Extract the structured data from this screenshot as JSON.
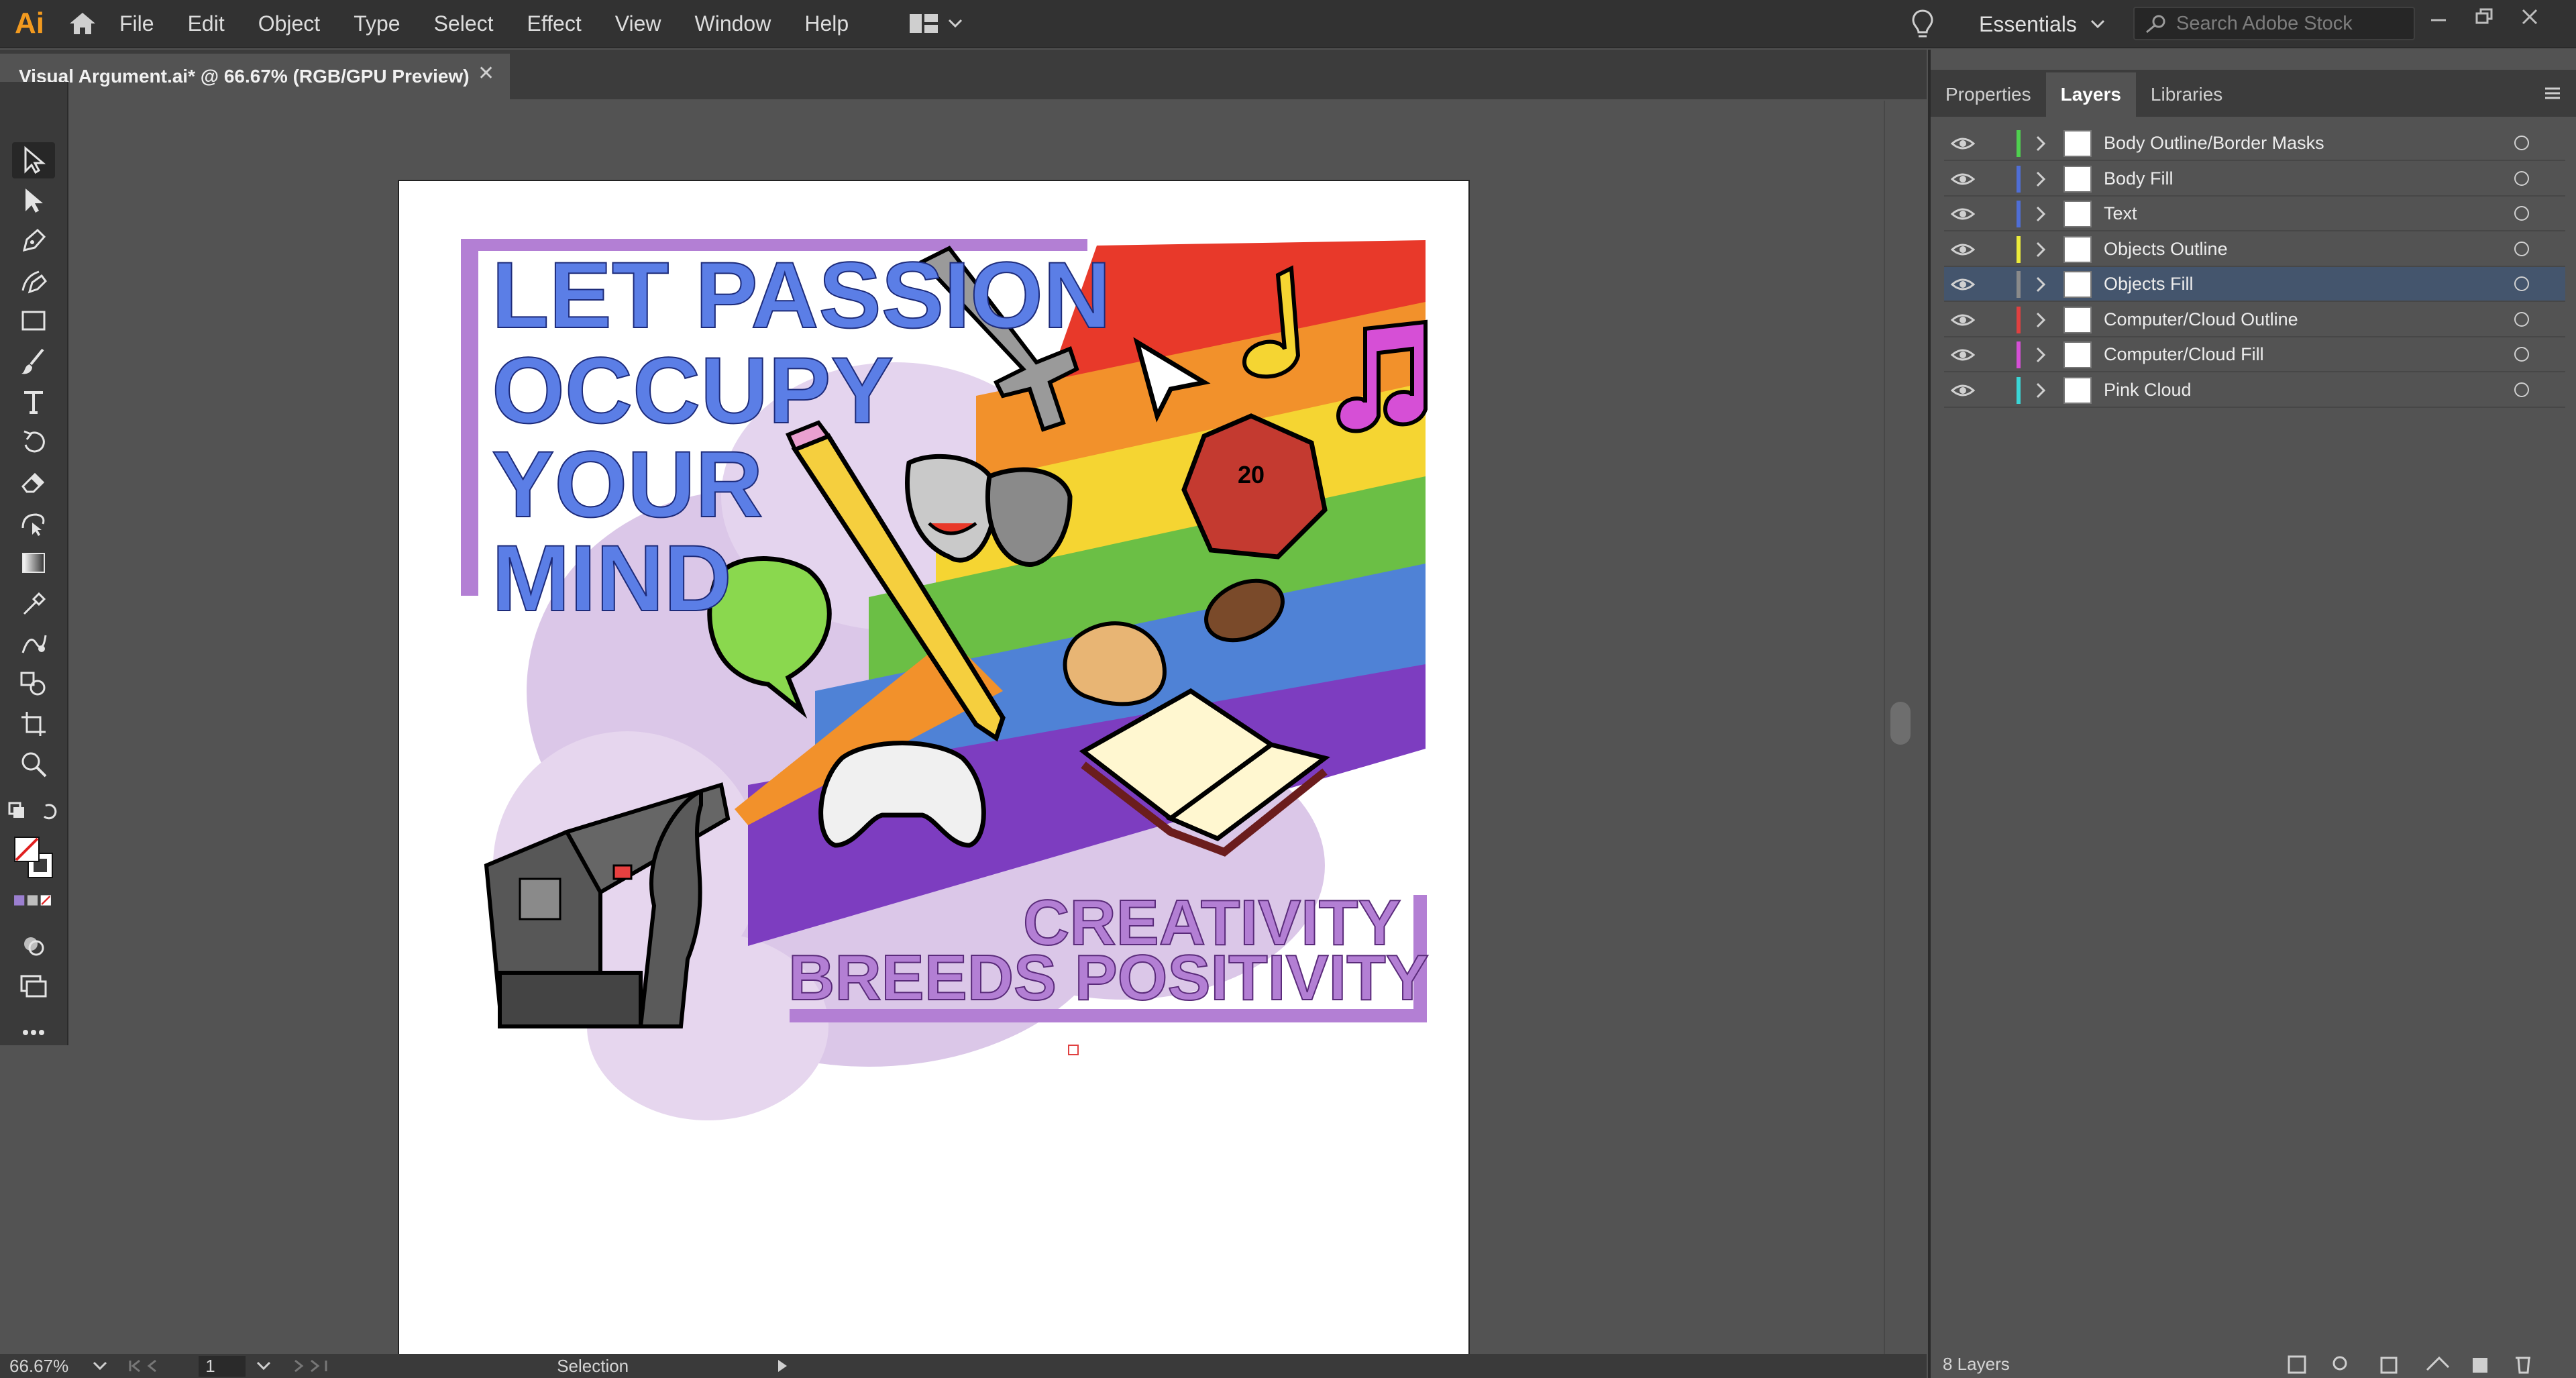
{
  "app": {
    "logo": "Ai",
    "menu": [
      "File",
      "Edit",
      "Object",
      "Type",
      "Select",
      "Effect",
      "View",
      "Window",
      "Help"
    ],
    "workspace": "Essentials",
    "search_placeholder": "Search Adobe Stock"
  },
  "document": {
    "tab_title": "Visual Argument.ai* @ 66.67% (RGB/GPU Preview)",
    "close_glyph": "✕"
  },
  "artwork": {
    "headline": [
      "LET PASSION",
      "OCCUPY",
      "YOUR",
      "MIND"
    ],
    "tagline": [
      "CREATIVITY",
      "BREEDS POSITIVITY"
    ],
    "dice_label": "20",
    "colors": {
      "headline": "#5b7ee6",
      "tagline": "#b37fd4",
      "purple_frame": "#b37fd4",
      "pink_cloud": "#d9c3e6"
    }
  },
  "status": {
    "zoom": "66.67%",
    "artboard": "1",
    "tool": "Selection"
  },
  "panel": {
    "tabs": [
      "Properties",
      "Layers",
      "Libraries"
    ],
    "active_tab": "Layers",
    "layers": [
      {
        "name": "Body Outline/Border Masks",
        "color": "#4fd14f",
        "selected": false
      },
      {
        "name": "Body Fill",
        "color": "#4f6ed6",
        "selected": false
      },
      {
        "name": "Text",
        "color": "#4f6ed6",
        "selected": false
      },
      {
        "name": "Objects Outline",
        "color": "#ecec3a",
        "selected": false
      },
      {
        "name": "Objects Fill",
        "color": "#8a8a8a",
        "selected": true
      },
      {
        "name": "Computer/Cloud Outline",
        "color": "#e04040",
        "selected": false
      },
      {
        "name": "Computer/Cloud Fill",
        "color": "#d64fd6",
        "selected": false
      },
      {
        "name": "Pink Cloud",
        "color": "#3ad6d6",
        "selected": false
      }
    ],
    "layer_count": "8 Layers"
  }
}
